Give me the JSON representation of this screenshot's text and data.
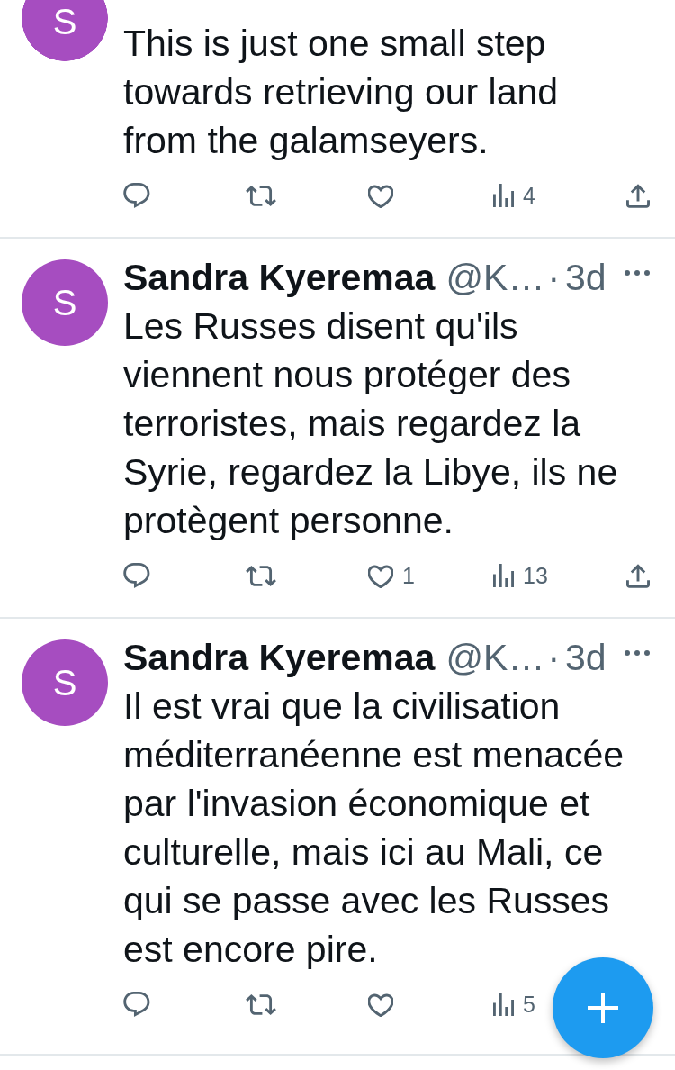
{
  "tweets": [
    {
      "avatar": "S",
      "text": "This is just one small step towards retrieving our land from the galamseyers.",
      "actions": [
        {
          "kind": "reply"
        },
        {
          "kind": "retweet"
        },
        {
          "kind": "like"
        },
        {
          "kind": "views",
          "count": "4"
        },
        {
          "kind": "share"
        }
      ]
    },
    {
      "avatar": "S",
      "name": "Sandra Kyeremaa",
      "handle": "@K…",
      "separator": "·",
      "time": "3d",
      "text": "Les Russes disent qu'ils viennent nous protéger des terroristes, mais regardez la Syrie, regardez la Libye, ils ne protègent personne.",
      "actions": [
        {
          "kind": "reply"
        },
        {
          "kind": "retweet"
        },
        {
          "kind": "like",
          "count": "1"
        },
        {
          "kind": "views",
          "count": "13"
        },
        {
          "kind": "share"
        }
      ]
    },
    {
      "avatar": "S",
      "name": "Sandra Kyeremaa",
      "handle": "@K…",
      "separator": "·",
      "time": "3d",
      "text": "Il est vrai que la civilisation méditerranéenne est menacée par l'invasion économique et culturelle, mais ici au Mali, ce qui se passe avec les Russes est encore pire.",
      "actions": [
        {
          "kind": "reply"
        },
        {
          "kind": "retweet"
        },
        {
          "kind": "like"
        },
        {
          "kind": "views",
          "count": "5"
        }
      ]
    }
  ]
}
